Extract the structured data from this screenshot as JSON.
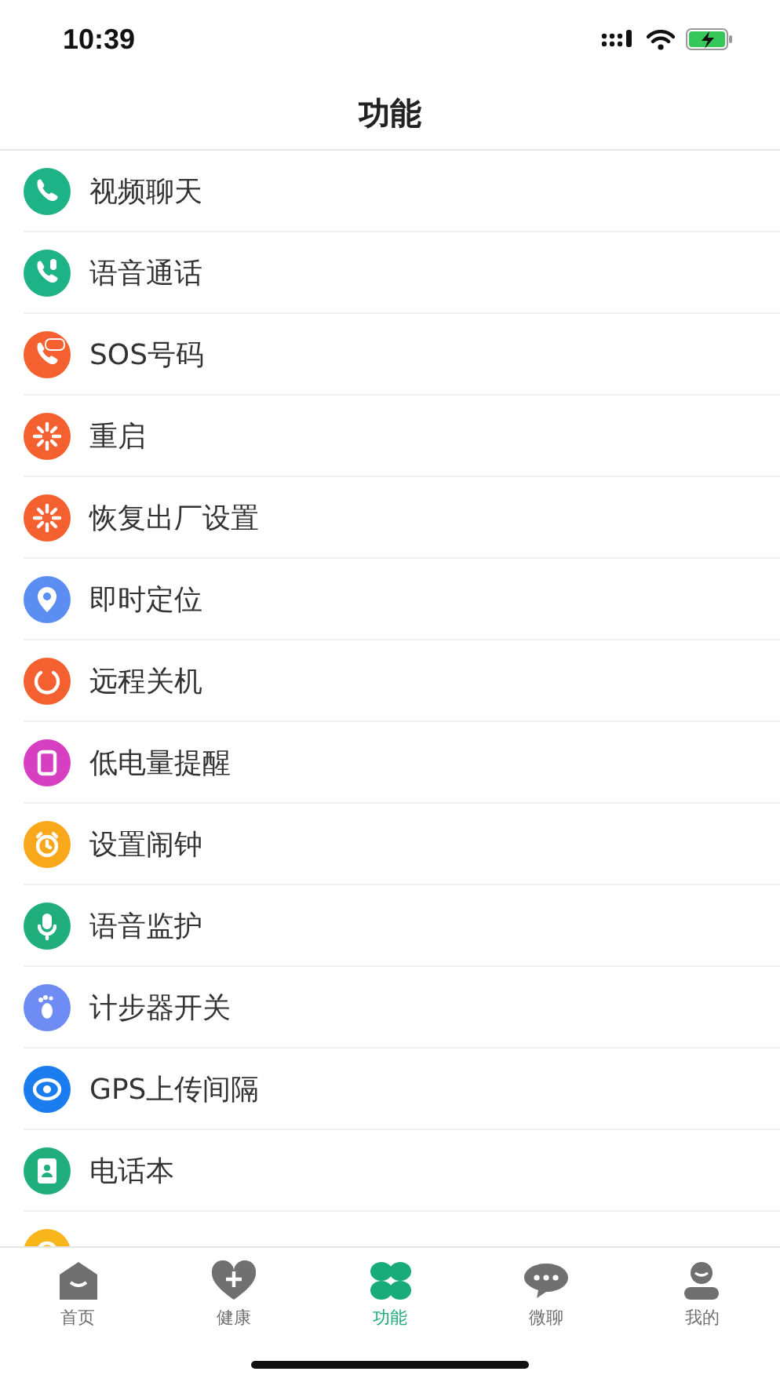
{
  "status_bar": {
    "time": "10:39"
  },
  "header": {
    "title": "功能"
  },
  "items": [
    {
      "label": "视频聊天",
      "color": "#1db386"
    },
    {
      "label": "语音通话",
      "color": "#1db386"
    },
    {
      "label": "SOS号码",
      "color": "#f4602f"
    },
    {
      "label": "重启",
      "color": "#f4602f"
    },
    {
      "label": "恢复出厂设置",
      "color": "#f4602f"
    },
    {
      "label": "即时定位",
      "color": "#5b8ef0"
    },
    {
      "label": "远程关机",
      "color": "#f4602f"
    },
    {
      "label": "低电量提醒",
      "color": "#d63fc1"
    },
    {
      "label": "设置闹钟",
      "color": "#f9a81b"
    },
    {
      "label": "语音监护",
      "color": "#1fae7c"
    },
    {
      "label": "计步器开关",
      "color": "#6f8cf5"
    },
    {
      "label": "GPS上传间隔",
      "color": "#1b7cf0"
    },
    {
      "label": "电话本",
      "color": "#1fae7c"
    },
    {
      "color": "#f9b61b"
    }
  ],
  "tabs": [
    {
      "label": "首页",
      "selected": false
    },
    {
      "label": "健康",
      "selected": false
    },
    {
      "label": "功能",
      "selected": true
    },
    {
      "label": "微聊",
      "selected": false
    },
    {
      "label": "我的",
      "selected": false
    }
  ]
}
